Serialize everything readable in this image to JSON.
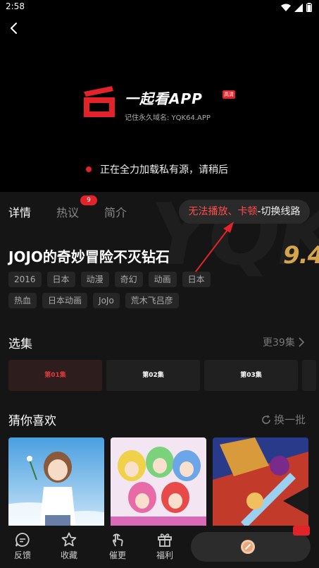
{
  "status": {
    "time": "2:58"
  },
  "player": {
    "logo_title": "一起看APP",
    "logo_tag": "高清",
    "logo_domain": "记住永久域名: YQK64.APP",
    "loading_text": "正在全力加载私有源，请稍后"
  },
  "tabs": {
    "items": [
      {
        "label": "详情",
        "active": true
      },
      {
        "label": "热议",
        "active": false,
        "badge": "9"
      },
      {
        "label": "简介",
        "active": false
      }
    ]
  },
  "switch_route": {
    "red_text": "无法播放、卡顿",
    "white_text": "-切换线路"
  },
  "show": {
    "title": "JOJO的奇妙冒险不灭钻石",
    "score": "9.4",
    "tags_row1": [
      "2016",
      "日本",
      "动漫",
      "奇幻",
      "动画",
      "日本"
    ],
    "tags_row2": [
      "热血",
      "日本动画",
      "JoJo",
      "荒木飞吕彦"
    ]
  },
  "episodes": {
    "title": "选集",
    "more": "更39集",
    "items": [
      "第01集",
      "第02集",
      "第03集"
    ]
  },
  "recommend": {
    "title": "猜你喜欢",
    "refresh": "换一批"
  },
  "bottom_nav": {
    "feedback": "反馈",
    "favorite": "收藏",
    "urge": "催更",
    "welfare": "福利"
  },
  "colors": {
    "accent": "#e2232a",
    "score": "#d6a54a",
    "background": "#151515"
  }
}
